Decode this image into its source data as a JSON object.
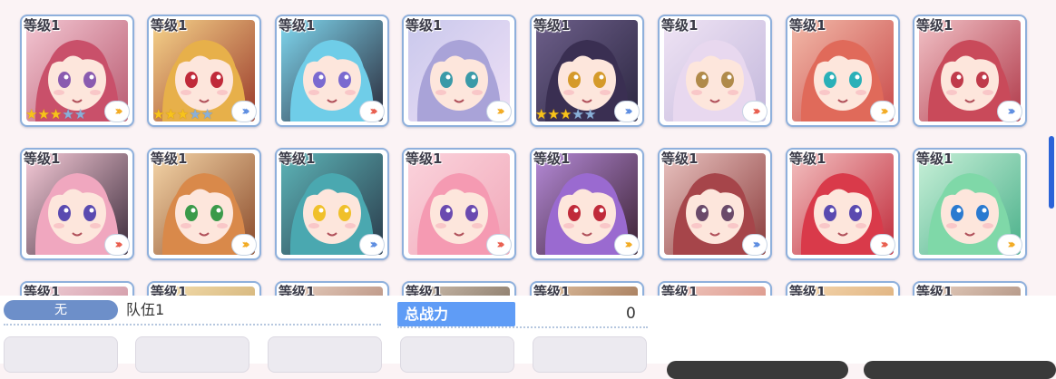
{
  "level_label": "等级1",
  "colors": {
    "accent_blue": "#5f9cf6",
    "card_border": "#8fb0dc",
    "scroll": "#2a63d8"
  },
  "rows": [
    [
      {
        "name": "char-1",
        "bg": [
          "#f3c6d2",
          "#b85a70"
        ],
        "hair": "#c9506a",
        "eyes": "#8a5bb0",
        "stars": 3
      },
      {
        "name": "char-2",
        "bg": [
          "#f6d38a",
          "#9a3a2a"
        ],
        "hair": "#e7b04a",
        "eyes": "#c02a3a",
        "stars": 3
      },
      {
        "name": "char-3",
        "bg": [
          "#7fd7ef",
          "#2a2a3a"
        ],
        "hair": "#6fcde8",
        "eyes": "#7a6ad0",
        "stars": 0
      },
      {
        "name": "char-4",
        "bg": [
          "#c9c8ec",
          "#efe0f6"
        ],
        "hair": "#a9a3d8",
        "eyes": "#3a9aa8",
        "stars": 0
      },
      {
        "name": "char-5",
        "bg": [
          "#6d5f8a",
          "#2b2640"
        ],
        "hair": "#3a2f52",
        "eyes": "#d59a2a",
        "stars": 3
      },
      {
        "name": "char-6",
        "bg": [
          "#efe3f4",
          "#c3b8dc"
        ],
        "hair": "#e8d8ef",
        "eyes": "#b08a4a",
        "stars": 0
      },
      {
        "name": "char-7",
        "bg": [
          "#f2b9a8",
          "#c94a4a"
        ],
        "hair": "#e06a5a",
        "eyes": "#2ab0b8",
        "stars": 0
      },
      {
        "name": "char-8",
        "bg": [
          "#f1c1c6",
          "#b03a4a"
        ],
        "hair": "#c94a5a",
        "eyes": "#c03a4a",
        "stars": 0
      }
    ],
    [
      {
        "name": "char-9",
        "bg": [
          "#f7cbd8",
          "#3a2a3a"
        ],
        "hair": "#f0a7bf",
        "eyes": "#5a4ab0",
        "stars": 0
      },
      {
        "name": "char-10",
        "bg": [
          "#f5d6a8",
          "#8a4a2a"
        ],
        "hair": "#d9894a",
        "eyes": "#3a9a4a",
        "stars": 0
      },
      {
        "name": "char-11",
        "bg": [
          "#5db5b8",
          "#2a3a4a"
        ],
        "hair": "#4aa8b0",
        "eyes": "#f0c02a",
        "stars": 0
      },
      {
        "name": "char-12",
        "bg": [
          "#fbd3dc",
          "#f0a7b8"
        ],
        "hair": "#f59ab2",
        "eyes": "#6a4ab0",
        "stars": 0
      },
      {
        "name": "char-13",
        "bg": [
          "#b58ad8",
          "#3a2030"
        ],
        "hair": "#9a6ad0",
        "eyes": "#c02a3a",
        "stars": 0
      },
      {
        "name": "char-14",
        "bg": [
          "#e9c3c0",
          "#8a3a3a"
        ],
        "hair": "#a6454a",
        "eyes": "#6a4a6a",
        "stars": 0
      },
      {
        "name": "char-15",
        "bg": [
          "#f3c0c0",
          "#c02a3a"
        ],
        "hair": "#d93a4a",
        "eyes": "#5a4ab0",
        "stars": 0
      },
      {
        "name": "char-16",
        "bg": [
          "#c8f0d8",
          "#4ab08a"
        ],
        "hair": "#7fd8a8",
        "eyes": "#2a7ad0",
        "stars": 0
      }
    ],
    [
      {
        "name": "char-17",
        "bg": [
          "#f0d0d8",
          "#c07a8a"
        ],
        "hair": "#c07a8a",
        "eyes": "#555",
        "stars": 0
      },
      {
        "name": "char-18",
        "bg": [
          "#f6e0b0",
          "#c09a5a"
        ],
        "hair": "#e0b45a",
        "eyes": "#555",
        "stars": 0
      },
      {
        "name": "char-19",
        "bg": [
          "#e8d0c0",
          "#a07060"
        ],
        "hair": "#a07060",
        "eyes": "#555",
        "stars": 0
      },
      {
        "name": "char-20",
        "bg": [
          "#d0c0b0",
          "#605040"
        ],
        "hair": "#6a5040",
        "eyes": "#555",
        "stars": 0
      },
      {
        "name": "char-21",
        "bg": [
          "#e0c0a0",
          "#805030"
        ],
        "hair": "#905a3a",
        "eyes": "#555",
        "stars": 0
      },
      {
        "name": "char-22",
        "bg": [
          "#f0c8c0",
          "#d07a6a"
        ],
        "hair": "#d07a6a",
        "eyes": "#555",
        "stars": 0
      },
      {
        "name": "char-23",
        "bg": [
          "#f6d8b0",
          "#d09a60"
        ],
        "hair": "#e8a060",
        "eyes": "#555",
        "stars": 0
      },
      {
        "name": "char-24",
        "bg": [
          "#e8d0c0",
          "#907060"
        ],
        "hair": "#907060",
        "eyes": "#555",
        "stars": 0
      }
    ]
  ],
  "panel": {
    "selector_label": "无",
    "team_name": "队伍1",
    "power_label": "总战力",
    "power_value": "0"
  }
}
